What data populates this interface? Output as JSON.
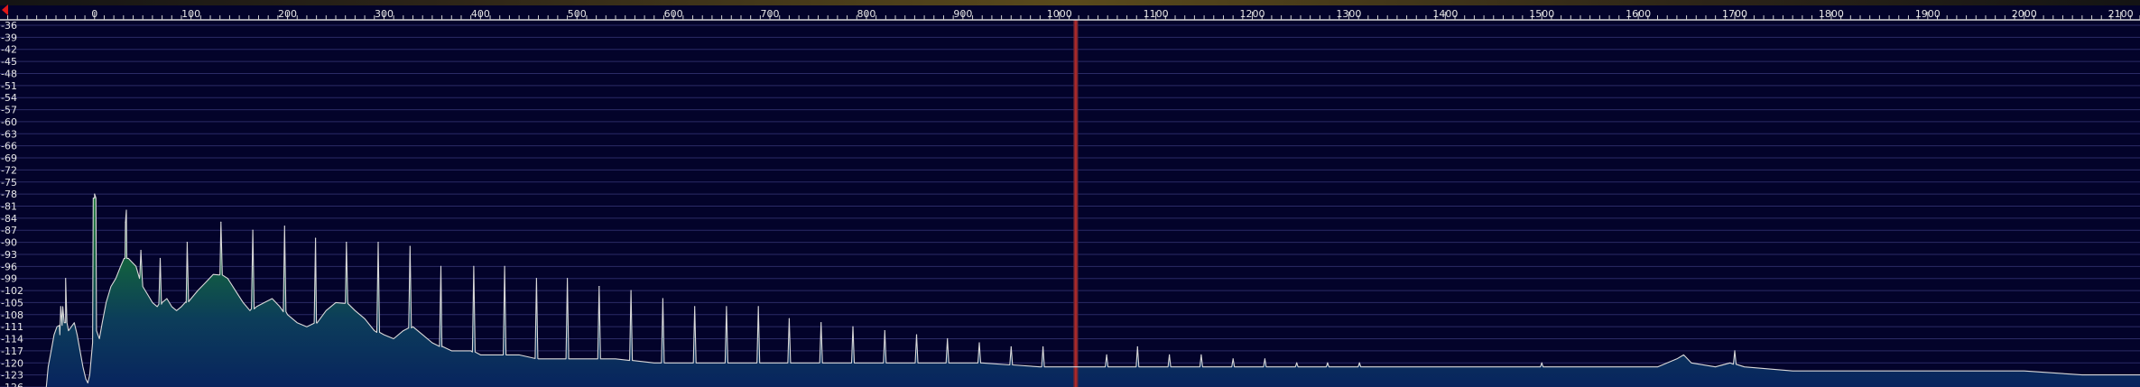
{
  "chart_data": {
    "type": "area",
    "title": "",
    "xlabel": "",
    "ylabel": "",
    "xlim": [
      -98,
      2120
    ],
    "ylim": [
      -126,
      -36
    ],
    "x_ticks": [
      0,
      100,
      200,
      300,
      400,
      500,
      600,
      700,
      800,
      900,
      1000,
      1100,
      1200,
      1300,
      1400,
      1500,
      1600,
      1700,
      1800,
      1900,
      2000,
      2100
    ],
    "y_ticks": [
      -36,
      -39,
      -42,
      -45,
      -48,
      -51,
      -54,
      -57,
      -60,
      -63,
      -66,
      -69,
      -72,
      -75,
      -78,
      -81,
      -84,
      -87,
      -90,
      -93,
      -96,
      -99,
      -102,
      -105,
      -108,
      -111,
      -114,
      -117,
      -120,
      -123,
      -126
    ],
    "grid": true,
    "reference_marker_x": 1017,
    "colors": {
      "background": "#03032a",
      "grid": "#2b2b66",
      "trace": "#d9d9d9",
      "fill_high": "#1f7a3a",
      "fill_low": "#08245e",
      "marker": "#b82828"
    },
    "series": [
      {
        "values": [
          [
            -50,
            -126
          ],
          [
            -48,
            -121
          ],
          [
            -45,
            -117
          ],
          [
            -42,
            -113
          ],
          [
            -39,
            -111
          ],
          [
            -36,
            -113
          ],
          [
            -33,
            -106
          ],
          [
            -30,
            -110
          ],
          [
            -27,
            -112
          ],
          [
            -24,
            -111
          ],
          [
            -21,
            -110
          ],
          [
            -18,
            -113
          ],
          [
            -15,
            -117
          ],
          [
            -12,
            -121
          ],
          [
            -9,
            -124
          ],
          [
            -7,
            -125
          ],
          [
            -5,
            -123
          ],
          [
            -2,
            -115
          ],
          [
            0,
            -79
          ],
          [
            2,
            -112
          ],
          [
            5,
            -114
          ],
          [
            8,
            -110
          ],
          [
            12,
            -105
          ],
          [
            17,
            -101
          ],
          [
            22,
            -99
          ],
          [
            27,
            -96
          ],
          [
            31,
            -94
          ],
          [
            35,
            -94
          ],
          [
            39,
            -95
          ],
          [
            43,
            -96
          ],
          [
            47,
            -98
          ],
          [
            50,
            -101
          ],
          [
            55,
            -103
          ],
          [
            60,
            -105
          ],
          [
            65,
            -106
          ],
          [
            70,
            -105
          ],
          [
            75,
            -104
          ],
          [
            80,
            -106
          ],
          [
            85,
            -107
          ],
          [
            90,
            -106
          ],
          [
            95,
            -105
          ],
          [
            100,
            -104
          ],
          [
            107,
            -102
          ],
          [
            115,
            -100
          ],
          [
            123,
            -98
          ],
          [
            130,
            -98
          ],
          [
            138,
            -99
          ],
          [
            146,
            -102
          ],
          [
            154,
            -105
          ],
          [
            161,
            -107
          ],
          [
            168,
            -106
          ],
          [
            176,
            -105
          ],
          [
            184,
            -104
          ],
          [
            192,
            -106
          ],
          [
            200,
            -108
          ],
          [
            210,
            -110
          ],
          [
            220,
            -111
          ],
          [
            230,
            -110
          ],
          [
            240,
            -107
          ],
          [
            250,
            -105
          ],
          [
            260,
            -105
          ],
          [
            270,
            -107
          ],
          [
            280,
            -109
          ],
          [
            290,
            -112
          ],
          [
            300,
            -113
          ],
          [
            310,
            -114
          ],
          [
            320,
            -112
          ],
          [
            330,
            -111
          ],
          [
            340,
            -113
          ],
          [
            350,
            -115
          ],
          [
            360,
            -116
          ],
          [
            370,
            -117
          ],
          [
            380,
            -117
          ],
          [
            390,
            -117
          ],
          [
            400,
            -118
          ],
          [
            420,
            -118
          ],
          [
            440,
            -118
          ],
          [
            460,
            -119
          ],
          [
            480,
            -119
          ],
          [
            500,
            -119
          ],
          [
            540,
            -119
          ],
          [
            580,
            -120
          ],
          [
            620,
            -120
          ],
          [
            680,
            -120
          ],
          [
            740,
            -120
          ],
          [
            800,
            -120
          ],
          [
            860,
            -120
          ],
          [
            920,
            -120
          ],
          [
            980,
            -121
          ],
          [
            1040,
            -121
          ],
          [
            1100,
            -121
          ],
          [
            1160,
            -121
          ],
          [
            1220,
            -121
          ],
          [
            1280,
            -121
          ],
          [
            1340,
            -121
          ],
          [
            1400,
            -121
          ],
          [
            1460,
            -121
          ],
          [
            1520,
            -121
          ],
          [
            1580,
            -121
          ],
          [
            1620,
            -121
          ],
          [
            1640,
            -119
          ],
          [
            1647,
            -118
          ],
          [
            1655,
            -120
          ],
          [
            1680,
            -121
          ],
          [
            1695,
            -120
          ],
          [
            1710,
            -121
          ],
          [
            1760,
            -122
          ],
          [
            1820,
            -122
          ],
          [
            1880,
            -122
          ],
          [
            1940,
            -122
          ],
          [
            2000,
            -122
          ],
          [
            2060,
            -123
          ],
          [
            2120,
            -123
          ]
        ]
      }
    ],
    "peaks": [
      [
        -35,
        -106
      ],
      [
        -30,
        -99
      ],
      [
        0,
        -78
      ],
      [
        32,
        -85
      ],
      [
        33,
        -82
      ],
      [
        48,
        -92
      ],
      [
        68,
        -94
      ],
      [
        96,
        -90
      ],
      [
        131,
        -85
      ],
      [
        164,
        -87
      ],
      [
        197,
        -86
      ],
      [
        229,
        -89
      ],
      [
        261,
        -90
      ],
      [
        294,
        -90
      ],
      [
        327,
        -91
      ],
      [
        359,
        -96
      ],
      [
        393,
        -96
      ],
      [
        425,
        -96
      ],
      [
        458,
        -99
      ],
      [
        490,
        -99
      ],
      [
        523,
        -101
      ],
      [
        556,
        -102
      ],
      [
        589,
        -104
      ],
      [
        622,
        -106
      ],
      [
        655,
        -106
      ],
      [
        688,
        -106
      ],
      [
        720,
        -109
      ],
      [
        753,
        -110
      ],
      [
        786,
        -111
      ],
      [
        819,
        -112
      ],
      [
        852,
        -113
      ],
      [
        884,
        -114
      ],
      [
        917,
        -115
      ],
      [
        950,
        -116
      ],
      [
        983,
        -116
      ],
      [
        1049,
        -118
      ],
      [
        1081,
        -116
      ],
      [
        1114,
        -118
      ],
      [
        1147,
        -118
      ],
      [
        1180,
        -119
      ],
      [
        1213,
        -119
      ],
      [
        1246,
        -120
      ],
      [
        1278,
        -120
      ],
      [
        1311,
        -120
      ],
      [
        1500,
        -120
      ],
      [
        1700,
        -117
      ]
    ]
  }
}
